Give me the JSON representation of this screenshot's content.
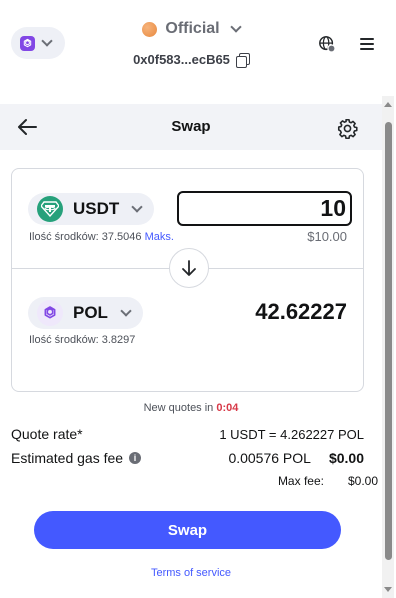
{
  "header": {
    "account_name": "Official",
    "address": "0x0f583...ecB65",
    "network_color": "#8247e5"
  },
  "page": {
    "title": "Swap"
  },
  "from": {
    "symbol": "USDT",
    "icon": "tether-icon",
    "icon_color": "#26a17b",
    "balance_label": "Ilość środków: 37.5046",
    "max_label": "Maks.",
    "amount": "10",
    "fiat": "$10.00"
  },
  "to": {
    "symbol": "POL",
    "icon": "polygon-icon",
    "icon_color": "#8247e5",
    "balance_label": "Ilość środków: 3.8297",
    "amount": "42.62227"
  },
  "quote": {
    "timer_label": "New quotes in",
    "timer_value": "0:04",
    "rate_label": "Quote rate*",
    "rate_value": "1 USDT = 4.262227 POL",
    "gas_label": "Estimated gas fee",
    "gas_token": "0.00576 POL",
    "gas_usd": "$0.00",
    "max_fee_label": "Max fee:",
    "max_fee_value": "$0.00"
  },
  "actions": {
    "swap_label": "Swap",
    "terms_label": "Terms of service"
  },
  "colors": {
    "accent": "#4459ff",
    "timer_red": "#d73847"
  }
}
